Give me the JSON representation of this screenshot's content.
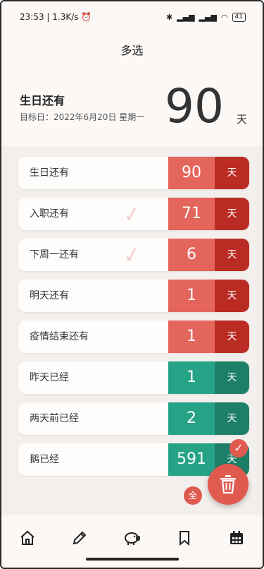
{
  "status_bar": {
    "time_speed": "23:53 | 1.3K/s",
    "alarm_icon": "alarm-icon",
    "signal_text": "ᵃᵃₗ ᵃᵃₗ",
    "battery": "41"
  },
  "header": {
    "title": "多选"
  },
  "hero": {
    "label": "生日还有",
    "target_date": "目标日：2022年6月20日 星期一",
    "days": "90",
    "unit": "天"
  },
  "items": [
    {
      "label": "生日还有",
      "num": "90",
      "unit": "天",
      "type": "future",
      "selected": false
    },
    {
      "label": "入职还有",
      "num": "71",
      "unit": "天",
      "type": "future",
      "selected": true
    },
    {
      "label": "下周一还有",
      "num": "6",
      "unit": "天",
      "type": "future",
      "selected": true
    },
    {
      "label": "明天还有",
      "num": "1",
      "unit": "天",
      "type": "future",
      "selected": false
    },
    {
      "label": "疫情结束还有",
      "num": "1",
      "unit": "天",
      "type": "future",
      "selected": false
    },
    {
      "label": "昨天已经",
      "num": "1",
      "unit": "天",
      "type": "past",
      "selected": false
    },
    {
      "label": "两天前已经",
      "num": "2",
      "unit": "天",
      "type": "past",
      "selected": false
    },
    {
      "label": "鹅已经",
      "num": "591",
      "unit": "天",
      "type": "past",
      "selected": false
    }
  ],
  "actions": {
    "check_badge": "✓",
    "select_all_label": "全"
  },
  "nav": [
    "home-icon",
    "pencil-icon",
    "piggy-bank-icon",
    "bookmark-icon",
    "calendar-icon"
  ],
  "colors": {
    "future": "#e4655b",
    "future_dark": "#ba2c23",
    "past": "#26a387",
    "past_dark": "#1e7f69",
    "accent": "#e05a4f"
  }
}
